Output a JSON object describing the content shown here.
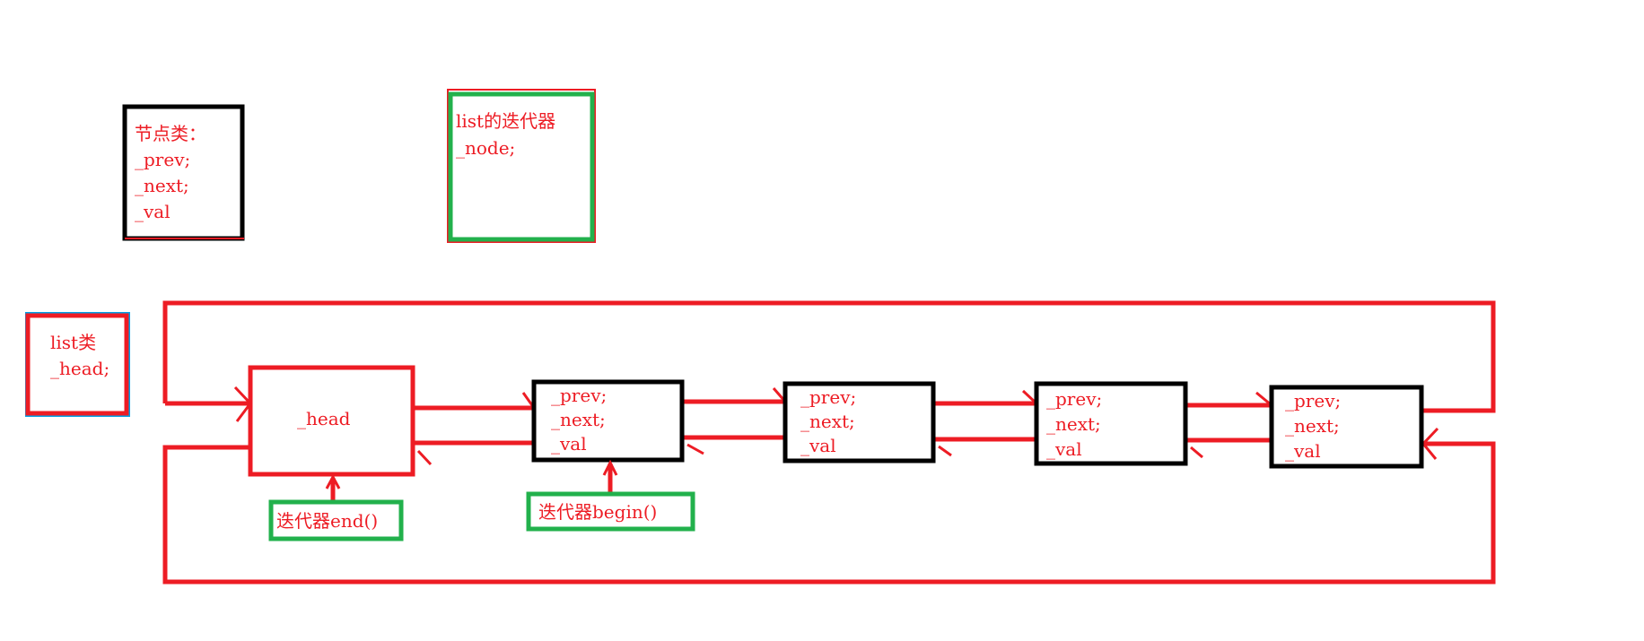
{
  "node_class": {
    "title": "节点类：",
    "fields": [
      "_prev;",
      "_next;",
      "_val"
    ]
  },
  "iterator_class": {
    "title": "list的迭代器",
    "fields": [
      "_node;"
    ]
  },
  "list_class": {
    "title": "list类",
    "fields": [
      "_head;"
    ]
  },
  "head_node": {
    "label": "_head"
  },
  "nodes": [
    {
      "fields": [
        "_prev;",
        "_next;",
        "_val"
      ]
    },
    {
      "fields": [
        "_prev;",
        "_next;",
        "_val"
      ]
    },
    {
      "fields": [
        "_prev;",
        "_next;",
        "_val"
      ]
    },
    {
      "fields": [
        "_prev;",
        "_next;",
        "_val"
      ]
    }
  ],
  "end_iterator": {
    "label": "迭代器end()"
  },
  "begin_iterator": {
    "label": "迭代器begin()"
  },
  "colors": {
    "red": "#ed1c24",
    "green": "#22b14c",
    "black": "#000000",
    "blue": "#00a2e8"
  }
}
